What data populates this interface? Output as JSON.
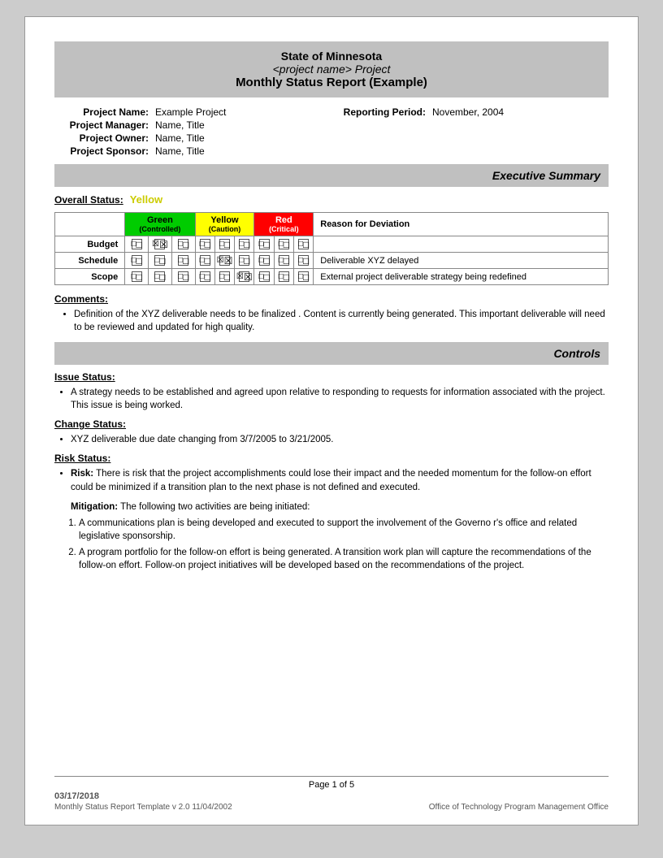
{
  "header": {
    "line1": "State of Minnesota",
    "line2": "<project name> Project",
    "line3": "Monthly Status Report (Example)"
  },
  "project": {
    "name_label": "Project Name:",
    "name_value": "Example Project",
    "reporting_label": "Reporting Period:",
    "reporting_value": "November, 2004",
    "manager_label": "Project Manager:",
    "manager_value": "Name, Title",
    "owner_label": "Project Owner:",
    "owner_value": "Name, Title",
    "sponsor_label": "Project Sponsor:",
    "sponsor_value": "Name, Title"
  },
  "executive_summary": {
    "header": "Executive Summary",
    "overall_status_label": "Overall Status:",
    "overall_status_value": "Yellow",
    "table": {
      "headers": {
        "green": "Green",
        "green_sub": "(Controlled)",
        "yellow": "Yellow",
        "yellow_sub": "(Caution)",
        "red": "Red",
        "red_sub": "(Critical)",
        "reason": "Reason for Deviation"
      },
      "rows": [
        {
          "label": "Budget",
          "green": [
            "empty",
            "checked",
            "empty"
          ],
          "yellow": [
            "empty",
            "empty",
            "empty"
          ],
          "red": [
            "empty",
            "empty",
            "empty"
          ],
          "reason": ""
        },
        {
          "label": "Schedule",
          "green": [
            "empty",
            "empty",
            "empty"
          ],
          "yellow": [
            "empty",
            "checked",
            "empty"
          ],
          "red": [
            "empty",
            "empty",
            "empty"
          ],
          "reason": "Deliverable XYZ delayed"
        },
        {
          "label": "Scope",
          "green": [
            "empty",
            "empty",
            "empty"
          ],
          "yellow": [
            "empty",
            "empty",
            "checked"
          ],
          "red": [
            "empty",
            "empty",
            "empty"
          ],
          "reason": "External project deliverable strategy being redefined"
        }
      ]
    }
  },
  "comments": {
    "label": "Comments:",
    "items": [
      "Definition of the XYZ deliverable  needs to be finalized .  Content is currently being generated.  This important deliverable will need to be reviewed and updated for high quality."
    ]
  },
  "controls": {
    "header": "Controls",
    "issue_status_label": "Issue Status:",
    "issue_items": [
      "A strategy needs to be established and agreed upon relative to  responding to  requests for information associated with the project.  This issue is being worked."
    ],
    "change_status_label": "Change Status:",
    "change_items": [
      "XYZ  deliverable due date changing from   3/7/2005 to 3/21/2005."
    ],
    "risk_status_label": "Risk Status:",
    "risk_items": [
      {
        "bold_prefix": "Risk:",
        "text": " There is risk that the project accomplishments could lose their impact and the needed momentum for the follow-on effort could be   minimized if a transition plan to the next phase is not defined and executed."
      }
    ],
    "mitigation_prefix": "Mitigation:",
    "mitigation_text": "  The following two activities are being initiated:",
    "mitigation_numbered": [
      "A communications plan is being developed and executed to support the involvement of the Governo r's office and related legislative sponsorship.",
      "A program portfolio for the follow-on effort is being generated.  A transition work plan will capture the recommendations of the follow-on effort. Follow-on project initiatives will be developed based on the recommendations of the project."
    ]
  },
  "footer": {
    "date": "03/17/2018",
    "page": "Page 1 of 5",
    "template": "Monthly Status Report Template  v 2.0  11/04/2002",
    "office": "Office of Technology Program Management Office"
  }
}
